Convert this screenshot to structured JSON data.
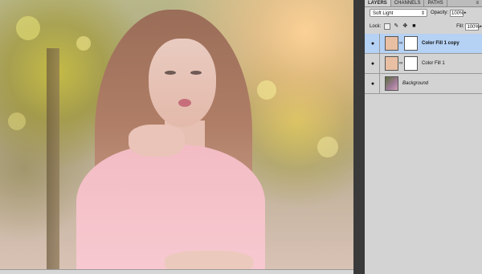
{
  "panel": {
    "tabs": [
      "LAYERS",
      "CHANNELS",
      "PATHS"
    ],
    "more_icon": "panel-menu-icon",
    "blend_mode": "Soft Light",
    "opacity_label": "Opacity:",
    "opacity_value": "100%",
    "lock_label": "Lock:",
    "fill_label": "Fill:",
    "fill_value": "100%",
    "layers": [
      {
        "name": "Color Fill 1 copy",
        "selected": true,
        "visible": true
      },
      {
        "name": "Color Fill 1",
        "selected": false,
        "visible": true
      },
      {
        "name": "Background",
        "selected": false,
        "visible": true
      }
    ]
  },
  "colors": {
    "fill_swatch": "#e8bfa3",
    "selection": "#b5d1f3",
    "panel_bg": "#d3d3d3"
  }
}
